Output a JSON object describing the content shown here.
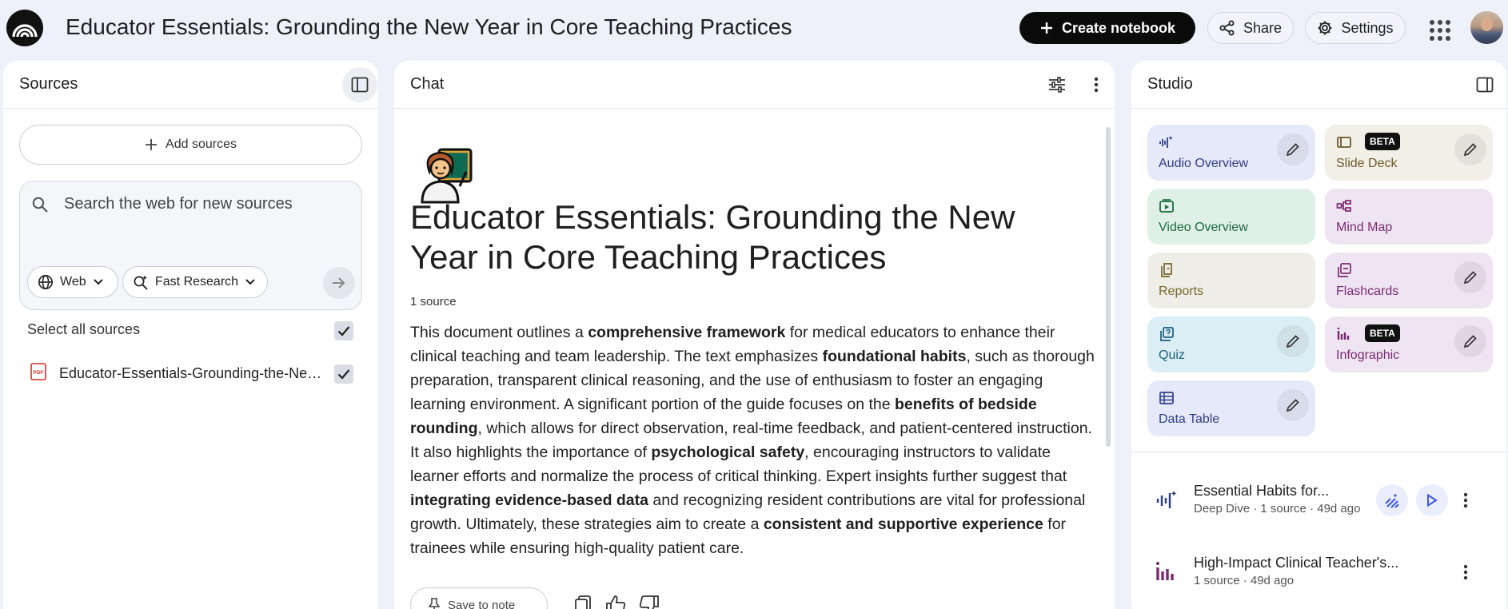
{
  "header": {
    "title": "Educator Essentials: Grounding the New Year in Core Teaching Practices",
    "create_label": "Create notebook",
    "share_label": "Share",
    "settings_label": "Settings"
  },
  "sources": {
    "title": "Sources",
    "add_label": "Add sources",
    "search_placeholder": "Search the web for new sources",
    "web_chip": "Web",
    "research_chip": "Fast Research",
    "select_all_label": "Select all sources",
    "items": [
      {
        "name": "Educator-Essentials-Grounding-the-New-Year-in-Core-Teaching-Practices.pdf",
        "icon": "pdf-icon",
        "checked": true
      }
    ]
  },
  "chat": {
    "title": "Chat",
    "notebook_title": "Educator Essentials: Grounding the New Year in Core Teaching Practices",
    "source_count": "1 source",
    "summary": [
      {
        "t": "This document outlines a ",
        "b": false
      },
      {
        "t": "comprehensive framework",
        "b": true
      },
      {
        "t": " for medical educators to enhance their clinical teaching and team leadership. The text emphasizes ",
        "b": false
      },
      {
        "t": "foundational habits",
        "b": true
      },
      {
        "t": ", such as thorough preparation, transparent clinical reasoning, and the use of enthusiasm to foster an engaging learning environment. A significant portion of the guide focuses on the ",
        "b": false
      },
      {
        "t": "benefits of bedside rounding",
        "b": true
      },
      {
        "t": ", which allows for direct observation, real-time feedback, and patient-centered instruction. It also highlights the importance of ",
        "b": false
      },
      {
        "t": "psychological safety",
        "b": true
      },
      {
        "t": ", encouraging instructors to validate learner efforts and normalize the process of critical thinking. Expert insights further suggest that ",
        "b": false
      },
      {
        "t": "integrating evidence-based data",
        "b": true
      },
      {
        "t": " and recognizing resident contributions are vital for professional growth. Ultimately, these strategies aim to create a ",
        "b": false
      },
      {
        "t": "consistent and supportive experience",
        "b": true
      },
      {
        "t": " for trainees while ensuring high-quality patient care.",
        "b": false
      }
    ],
    "save_note_label": "Save to note"
  },
  "studio": {
    "title": "Studio",
    "beta_label": "BETA",
    "tiles": {
      "audio": "Audio Overview",
      "slides": "Slide Deck",
      "video": "Video Overview",
      "mindmap": "Mind Map",
      "reports": "Reports",
      "flashcards": "Flashcards",
      "quiz": "Quiz",
      "infographic": "Infographic",
      "datatable": "Data Table"
    },
    "artifacts": [
      {
        "title": "Essential Habits for...",
        "meta": "Deep Dive · 1 source · 49d ago",
        "icon": "audio-wave-icon"
      },
      {
        "title": "High-Impact Clinical Teacher's...",
        "meta": "1 source · 49d ago",
        "icon": "infographic-icon"
      }
    ]
  },
  "colors": {
    "accent": "#0b0b0b",
    "page_bg": "#eef0fa",
    "audio_tile": "#e6e9f9",
    "video_tile": "#dff1e6"
  }
}
